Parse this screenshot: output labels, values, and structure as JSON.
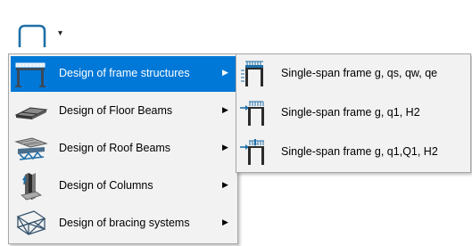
{
  "toolbar": {
    "main_icon": "frame-icon",
    "dropdown_icon": "chevron-down-icon",
    "dropdown_glyph": "▾"
  },
  "menu": {
    "items": [
      {
        "label": "Design of frame structures",
        "icon": "frame-structure-icon",
        "active": true
      },
      {
        "label": "Design of Floor Beams",
        "icon": "floor-beam-icon",
        "active": false
      },
      {
        "label": "Design of Roof Beams",
        "icon": "roof-beam-icon",
        "active": false
      },
      {
        "label": "Design of Columns",
        "icon": "column-icon",
        "active": false
      },
      {
        "label": "Design of bracing systems",
        "icon": "bracing-system-icon",
        "active": false
      }
    ],
    "arrow_glyph": "▶"
  },
  "submenu": {
    "items": [
      {
        "label": "Single-span frame g, qs, qw, qe",
        "icon": "single-span-frame-icon"
      },
      {
        "label": "Single-span frame g, q1, H2",
        "icon": "single-span-frame-h-icon"
      },
      {
        "label": "Single-span frame g, q1,Q1, H2",
        "icon": "single-span-frame-qh-icon"
      }
    ]
  },
  "colors": {
    "highlight": "#0078d7",
    "menu_bg": "#f2f2f2",
    "icon_blue": "#1f6fa8",
    "icon_dark": "#2b2b2b"
  }
}
